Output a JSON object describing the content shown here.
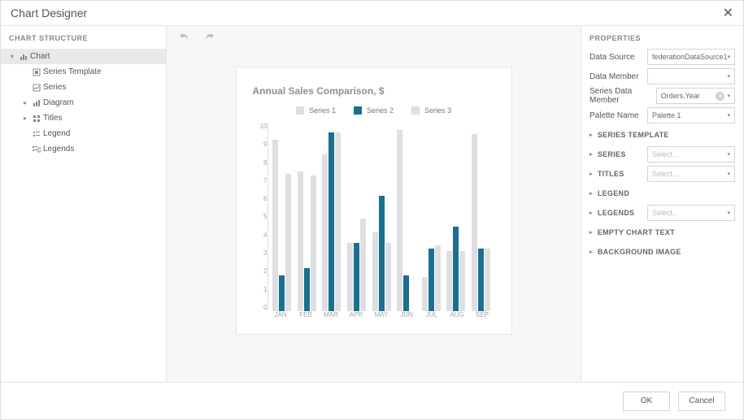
{
  "header": {
    "title": "Chart Designer"
  },
  "left_panel_title": "CHART STRUCTURE",
  "tree": {
    "chart": "Chart",
    "series_template": "Series Template",
    "series": "Series",
    "diagram": "Diagram",
    "titles": "Titles",
    "legend": "Legend",
    "legends": "Legends"
  },
  "properties": {
    "panel_title": "PROPERTIES",
    "data_source": {
      "label": "Data Source",
      "value": "federationDataSource1"
    },
    "data_member": {
      "label": "Data Member",
      "value": ""
    },
    "series_data_member": {
      "label": "Series Data Member",
      "value": "Orders.Year"
    },
    "palette_name": {
      "label": "Palette Name",
      "value": "Palette 1"
    },
    "sections": {
      "series_template": "SERIES TEMPLATE",
      "series": "SERIES",
      "titles": "TITLES",
      "legend": "LEGEND",
      "legends": "LEGENDS",
      "empty_chart_text": "EMPTY CHART TEXT",
      "background_image": "BACKGROUND IMAGE"
    },
    "select_placeholder": "Select..."
  },
  "footer": {
    "ok": "OK",
    "cancel": "Cancel"
  },
  "chart_data": {
    "type": "bar",
    "title": "Annual Sales Comparison, $",
    "categories": [
      "JAN",
      "FEB",
      "MAR",
      "APR",
      "MAY",
      "JUN",
      "JUL",
      "AUG",
      "SEP"
    ],
    "series": [
      {
        "name": "Series 1",
        "color": "#dedfe3",
        "values": [
          9.1,
          7.4,
          8.3,
          3.6,
          4.2,
          9.6,
          1.8,
          3.2,
          9.4
        ]
      },
      {
        "name": "Series 2",
        "color": "#1b6f8f",
        "values": [
          1.9,
          2.3,
          9.5,
          3.6,
          6.1,
          1.9,
          3.3,
          4.5,
          3.3
        ]
      },
      {
        "name": "Series 3",
        "color": "#dedfe3",
        "values": [
          7.3,
          7.2,
          9.5,
          4.9,
          3.6,
          null,
          3.5,
          3.2,
          3.3
        ]
      }
    ],
    "ylim": [
      0,
      10
    ],
    "yticks": [
      10,
      9,
      8,
      7,
      6,
      5,
      4,
      3,
      2,
      1,
      0
    ]
  }
}
